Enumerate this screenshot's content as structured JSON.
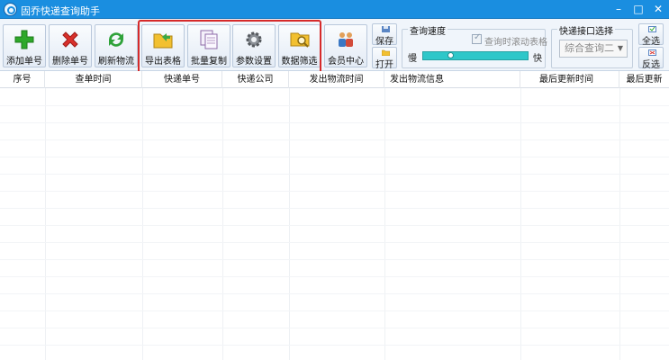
{
  "window": {
    "title": "固乔快递查询助手",
    "min": "–",
    "max": "□",
    "close": "✕"
  },
  "toolbar": {
    "buttons": [
      {
        "label": "添加单号",
        "icon": "add-icon"
      },
      {
        "label": "删除单号",
        "icon": "delete-icon"
      },
      {
        "label": "刷新物流",
        "icon": "refresh-icon"
      },
      {
        "label": "导出表格",
        "icon": "export-folder-icon"
      },
      {
        "label": "批量复制",
        "icon": "copy-icon"
      },
      {
        "label": "参数设置",
        "icon": "gear-icon"
      },
      {
        "label": "数据筛选",
        "icon": "filter-search-icon"
      },
      {
        "label": "会员中心",
        "icon": "members-icon"
      }
    ],
    "save_label": "保存",
    "open_label": "打开"
  },
  "speed": {
    "title": "查询速度",
    "auto_scroll_label": "查询时滚动表格",
    "slow_label": "慢",
    "fast_label": "快",
    "value_fraction": 0.25
  },
  "api": {
    "title": "快递接口选择",
    "selected": "综合查询二"
  },
  "selection": {
    "select_all": "全选",
    "invert": "反选"
  },
  "table": {
    "columns": [
      "序号",
      "查单时间",
      "快递单号",
      "快递公司",
      "发出物流时间",
      "发出物流信息",
      "最后更新时间",
      "最后更新"
    ]
  },
  "colors": {
    "titlebar": "#1a8ee0",
    "highlight": "#d62a2a",
    "slider": "#2ec7c9"
  }
}
